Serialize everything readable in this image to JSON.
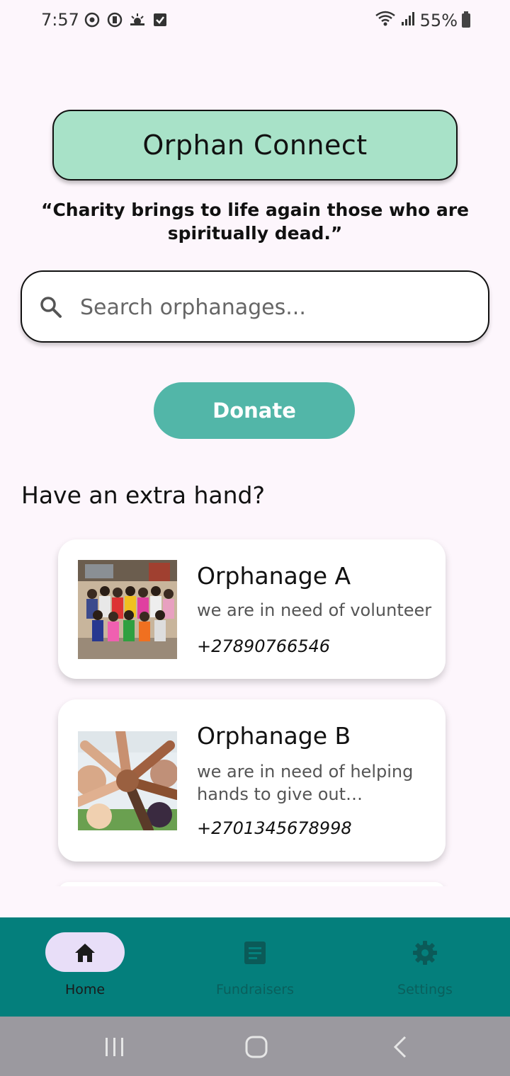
{
  "status_bar": {
    "time": "7:57",
    "battery": "55%"
  },
  "app": {
    "title": "Orphan Connect",
    "quote": "“Charity brings to life again those who are spiritually dead.”"
  },
  "search": {
    "placeholder": "Search orphanages..."
  },
  "donate": {
    "label": "Donate"
  },
  "section": {
    "title": "Have an extra hand?"
  },
  "orphanages": [
    {
      "name": "Orphanage A",
      "description": "we are in need of volunteer",
      "phone": "+27890766546"
    },
    {
      "name": "Orphanage B",
      "description": "we are in need of helping hands to give out donatio...",
      "phone": "+2701345678998"
    }
  ],
  "bottom_nav": {
    "items": [
      {
        "label": "Home",
        "icon": "home-icon",
        "selected": true
      },
      {
        "label": "Fundraisers",
        "icon": "document-icon",
        "selected": false
      },
      {
        "label": "Settings",
        "icon": "gear-icon",
        "selected": false
      }
    ]
  },
  "colors": {
    "header": "#a8e2c8",
    "accent": "#52b6a8",
    "nav_bar": "#047f7c",
    "nav_pill": "#e8def8",
    "background": "#fdf6fc"
  }
}
